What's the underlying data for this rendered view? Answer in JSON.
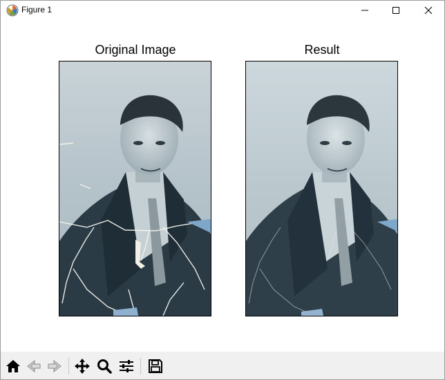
{
  "window": {
    "title": "Figure 1",
    "controls": {
      "minimize": "minimize",
      "maximize": "maximize",
      "close": "close"
    }
  },
  "figure": {
    "left_axes": {
      "title": "Original Image"
    },
    "right_axes": {
      "title": "Result"
    }
  },
  "toolbar": {
    "buttons": [
      {
        "name": "home",
        "icon": "home-icon"
      },
      {
        "name": "back",
        "icon": "back-arrow-icon"
      },
      {
        "name": "forward",
        "icon": "forward-arrow-icon"
      },
      {
        "name": "pan",
        "icon": "move-icon"
      },
      {
        "name": "zoom",
        "icon": "magnifier-icon"
      },
      {
        "name": "configure-subplots",
        "icon": "sliders-icon"
      },
      {
        "name": "save",
        "icon": "floppy-disk-icon"
      }
    ]
  },
  "colors": {
    "photo_background": "#b9c6cc",
    "photo_dark": "#243540",
    "crack": "#f2f2ee",
    "accent_blue": "#7fa7c9"
  }
}
